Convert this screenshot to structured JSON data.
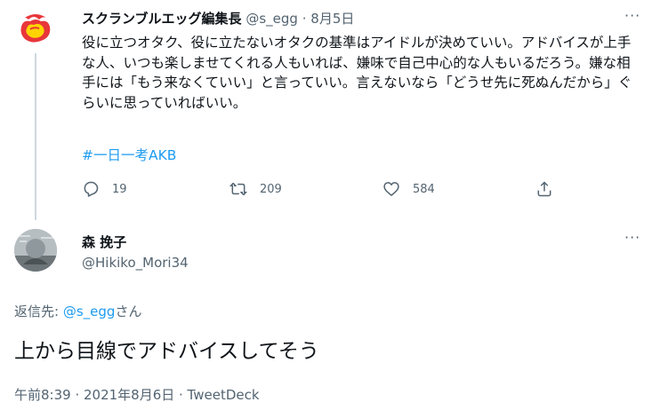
{
  "parent": {
    "display_name": "スクランブルエッグ編集長",
    "handle": "@s_egg",
    "separator": "·",
    "date": "8月5日",
    "more": "···",
    "text": "役に立つオタク、役に立たないオタクの基準はアイドルが決めていい。アドバイスが上手な人、いつも楽しませてくれる人もいれば、嫌味で自己中心的な人もいるだろう。嫌な相手には「もう来なくていい」と言っていい。言えないなら「どうせ先に死ぬんだから」ぐらいに思っていればいい。",
    "hashtag": "#一日一考AKB",
    "actions": {
      "reply_count": "19",
      "retweet_count": "209",
      "like_count": "584"
    }
  },
  "reply": {
    "display_name": "森 挽子",
    "handle": "@Hikiko_Mori34",
    "more": "···",
    "reply_prefix": "返信先:",
    "reply_handle": "@s_egg",
    "reply_suffix": "さん",
    "text": "上から目線でアドバイスしてそう",
    "timestamp": "午前8:39 · 2021年8月6日 · TweetDeck"
  },
  "colors": {
    "accent": "#1d9bf0",
    "muted": "#536471",
    "text": "#0f1419",
    "line": "#cfd9de"
  }
}
